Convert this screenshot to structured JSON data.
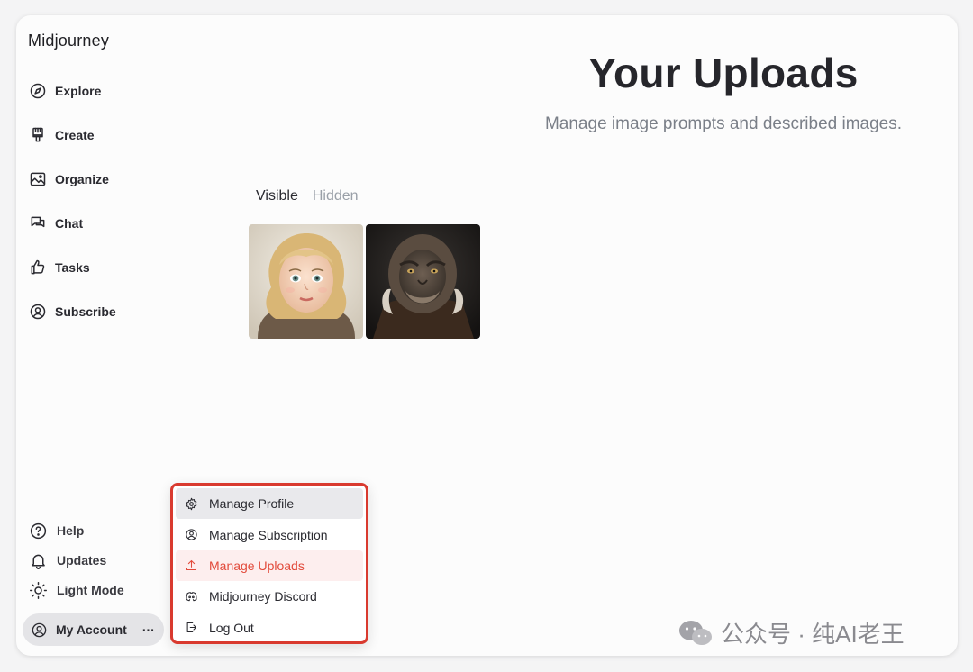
{
  "app": {
    "name": "Midjourney"
  },
  "sidebar": {
    "items": [
      {
        "label": "Explore",
        "icon": "compass-icon"
      },
      {
        "label": "Create",
        "icon": "brush-icon"
      },
      {
        "label": "Organize",
        "icon": "image-icon"
      },
      {
        "label": "Chat",
        "icon": "chat-icon"
      },
      {
        "label": "Tasks",
        "icon": "thumbs-up-icon"
      },
      {
        "label": "Subscribe",
        "icon": "user-circle-icon"
      }
    ],
    "bottom": [
      {
        "label": "Help",
        "icon": "question-icon"
      },
      {
        "label": "Updates",
        "icon": "bell-icon"
      },
      {
        "label": "Light Mode",
        "icon": "sun-icon"
      }
    ],
    "account": {
      "label": "My Account",
      "more": "···"
    }
  },
  "main": {
    "title": "Your Uploads",
    "subtitle": "Manage image prompts and described images.",
    "tabs": [
      {
        "label": "Visible",
        "active": true
      },
      {
        "label": "Hidden",
        "active": false
      }
    ],
    "thumbnails": [
      {
        "subject": "girl-portrait"
      },
      {
        "subject": "monkey-warrior"
      }
    ]
  },
  "account_menu": {
    "items": [
      {
        "label": "Manage Profile",
        "icon": "gear-icon",
        "state": "hover"
      },
      {
        "label": "Manage Subscription",
        "icon": "user-circle-icon",
        "state": "normal"
      },
      {
        "label": "Manage Uploads",
        "icon": "upload-icon",
        "state": "active"
      },
      {
        "label": "Midjourney Discord",
        "icon": "discord-icon",
        "state": "normal"
      },
      {
        "label": "Log Out",
        "icon": "logout-icon",
        "state": "normal"
      }
    ]
  },
  "watermark": {
    "text": "公众号 · 纯AI老王"
  },
  "colors": {
    "accent": "#e24a3b",
    "highlight_border": "#d93a2f",
    "text": "#2a2a30",
    "muted": "#7a7f88"
  }
}
